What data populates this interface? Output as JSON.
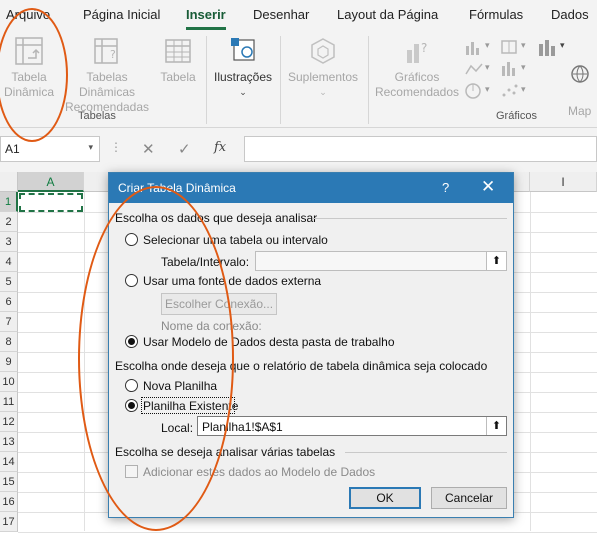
{
  "tabs": [
    "Arquivo",
    "Página Inicial",
    "Inserir",
    "Desenhar",
    "Layout da Página",
    "Fórmulas",
    "Dados"
  ],
  "active_tab": "Inserir",
  "ribbon": {
    "tabela_dinamica": [
      "Tabela",
      "Dinâmica"
    ],
    "tabelas_recomendadas": [
      "Tabelas Dinâmicas",
      "Recomendadas"
    ],
    "tabela": "Tabela",
    "ilustracoes": "Ilustrações",
    "suplementos": "Suplementos",
    "graficos_recomendados": [
      "Gráficos",
      "Recomendados"
    ],
    "mapas": "Map",
    "group_tabelas": "Tabelas",
    "group_graficos": "Gráficos"
  },
  "formula_bar": {
    "name_box": "A1",
    "cancel": "✕",
    "enter": "✓",
    "fx": "fx",
    "value": ""
  },
  "grid": {
    "columns": [
      "A",
      "I"
    ],
    "rows": [
      "1",
      "2",
      "3",
      "4",
      "5",
      "6",
      "7",
      "8",
      "9",
      "10",
      "11",
      "12",
      "13",
      "14",
      "15",
      "16",
      "17"
    ]
  },
  "dialog": {
    "title": "Criar Tabela Dinâmica",
    "help": "?",
    "close": "✕",
    "section1": "Escolha os dados que deseja analisar",
    "opt_table": "Selecionar uma tabela ou intervalo",
    "table_range_label": "Tabela/Intervalo:",
    "table_range_value": "",
    "opt_external": "Usar uma fonte de dados externa",
    "choose_connection": "Escolher Conexão...",
    "connection_name_label": "Nome da conexão:",
    "opt_data_model": "Usar Modelo de Dados desta pasta de trabalho",
    "section2": "Escolha onde deseja que o relatório de tabela dinâmica seja colocado",
    "opt_new_sheet": "Nova Planilha",
    "opt_existing_sheet": "Planilha Existente",
    "location_label": "Local:",
    "location_value": "Planilha1!$A$1",
    "section3": "Escolha se deseja analisar várias tabelas",
    "add_to_model": "Adicionar estes dados ao Modelo de Dados",
    "ok": "OK",
    "cancel": "Cancelar"
  },
  "colors": {
    "accent": "#217346",
    "dialog_title": "#2b79b5",
    "annotation": "#e05a14"
  }
}
